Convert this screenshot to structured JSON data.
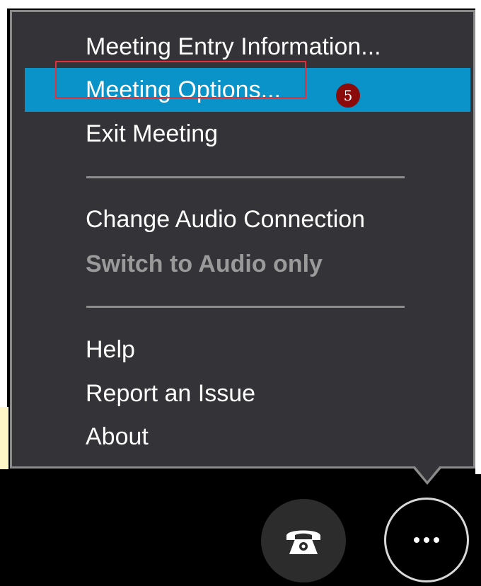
{
  "menu": {
    "items": [
      {
        "label": "Meeting Entry Information...",
        "state": "normal"
      },
      {
        "label": "Meeting Options...",
        "state": "highlighted"
      },
      {
        "label": "Exit Meeting",
        "state": "normal"
      },
      {
        "label": "Change Audio Connection",
        "state": "normal"
      },
      {
        "label": "Switch to Audio only",
        "state": "disabled"
      },
      {
        "label": "Help",
        "state": "normal"
      },
      {
        "label": "Report an Issue",
        "state": "normal"
      },
      {
        "label": "About",
        "state": "normal"
      }
    ]
  },
  "annotation": {
    "step_number": "5",
    "callout_color": "#e0303a",
    "badge_color": "#8b0a0a"
  },
  "toolbar": {
    "phone_icon": "phone-icon",
    "more_icon": "more-options-icon"
  },
  "colors": {
    "menu_background": "#333338",
    "highlight": "#0a93c9",
    "disabled_text": "#9a9a9a"
  }
}
